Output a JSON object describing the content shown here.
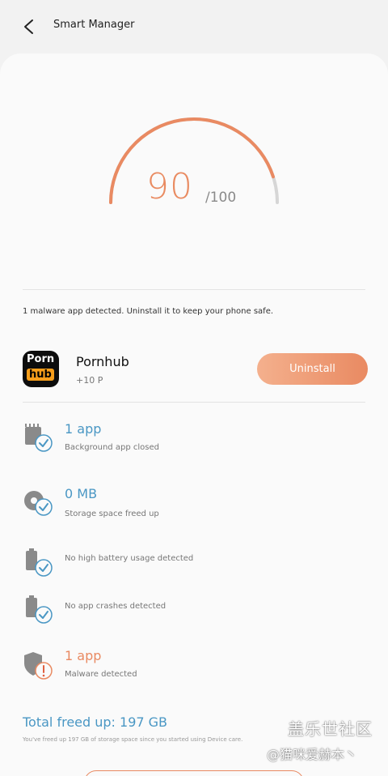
{
  "header": {
    "title": "Smart Manager"
  },
  "score": {
    "value": "90",
    "max": "/100",
    "fraction": 0.9
  },
  "malware_note": "1 malware app detected. Uninstall it to keep your phone safe.",
  "app": {
    "icon_text_top": "Porn",
    "icon_text_bottom": "hub",
    "name": "Pornhub",
    "points": "+10 P",
    "uninstall_label": "Uninstall"
  },
  "status_items": [
    {
      "icon": "memory-check-icon",
      "value": "1 app",
      "label": "Background app closed"
    },
    {
      "icon": "storage-check-icon",
      "value": "0 MB",
      "label": "Storage space freed up"
    },
    {
      "icon": "battery-check-icon",
      "label": "No high battery usage detected"
    },
    {
      "icon": "crash-check-icon",
      "label": "No app crashes detected"
    },
    {
      "icon": "shield-warning-icon",
      "value": "1 app",
      "label": "Malware detected"
    }
  ],
  "total": {
    "value": "Total freed up: 197 GB",
    "note": "You've freed up 197 GB of storage space since you started using Device care."
  },
  "watermark": {
    "title": "盖乐世社区",
    "subtitle": "@猫咪爱赫本丶"
  },
  "colors": {
    "accent_orange": "#e98a62",
    "accent_blue": "#4a97c4",
    "gauge_track": "#d6d6d6"
  }
}
